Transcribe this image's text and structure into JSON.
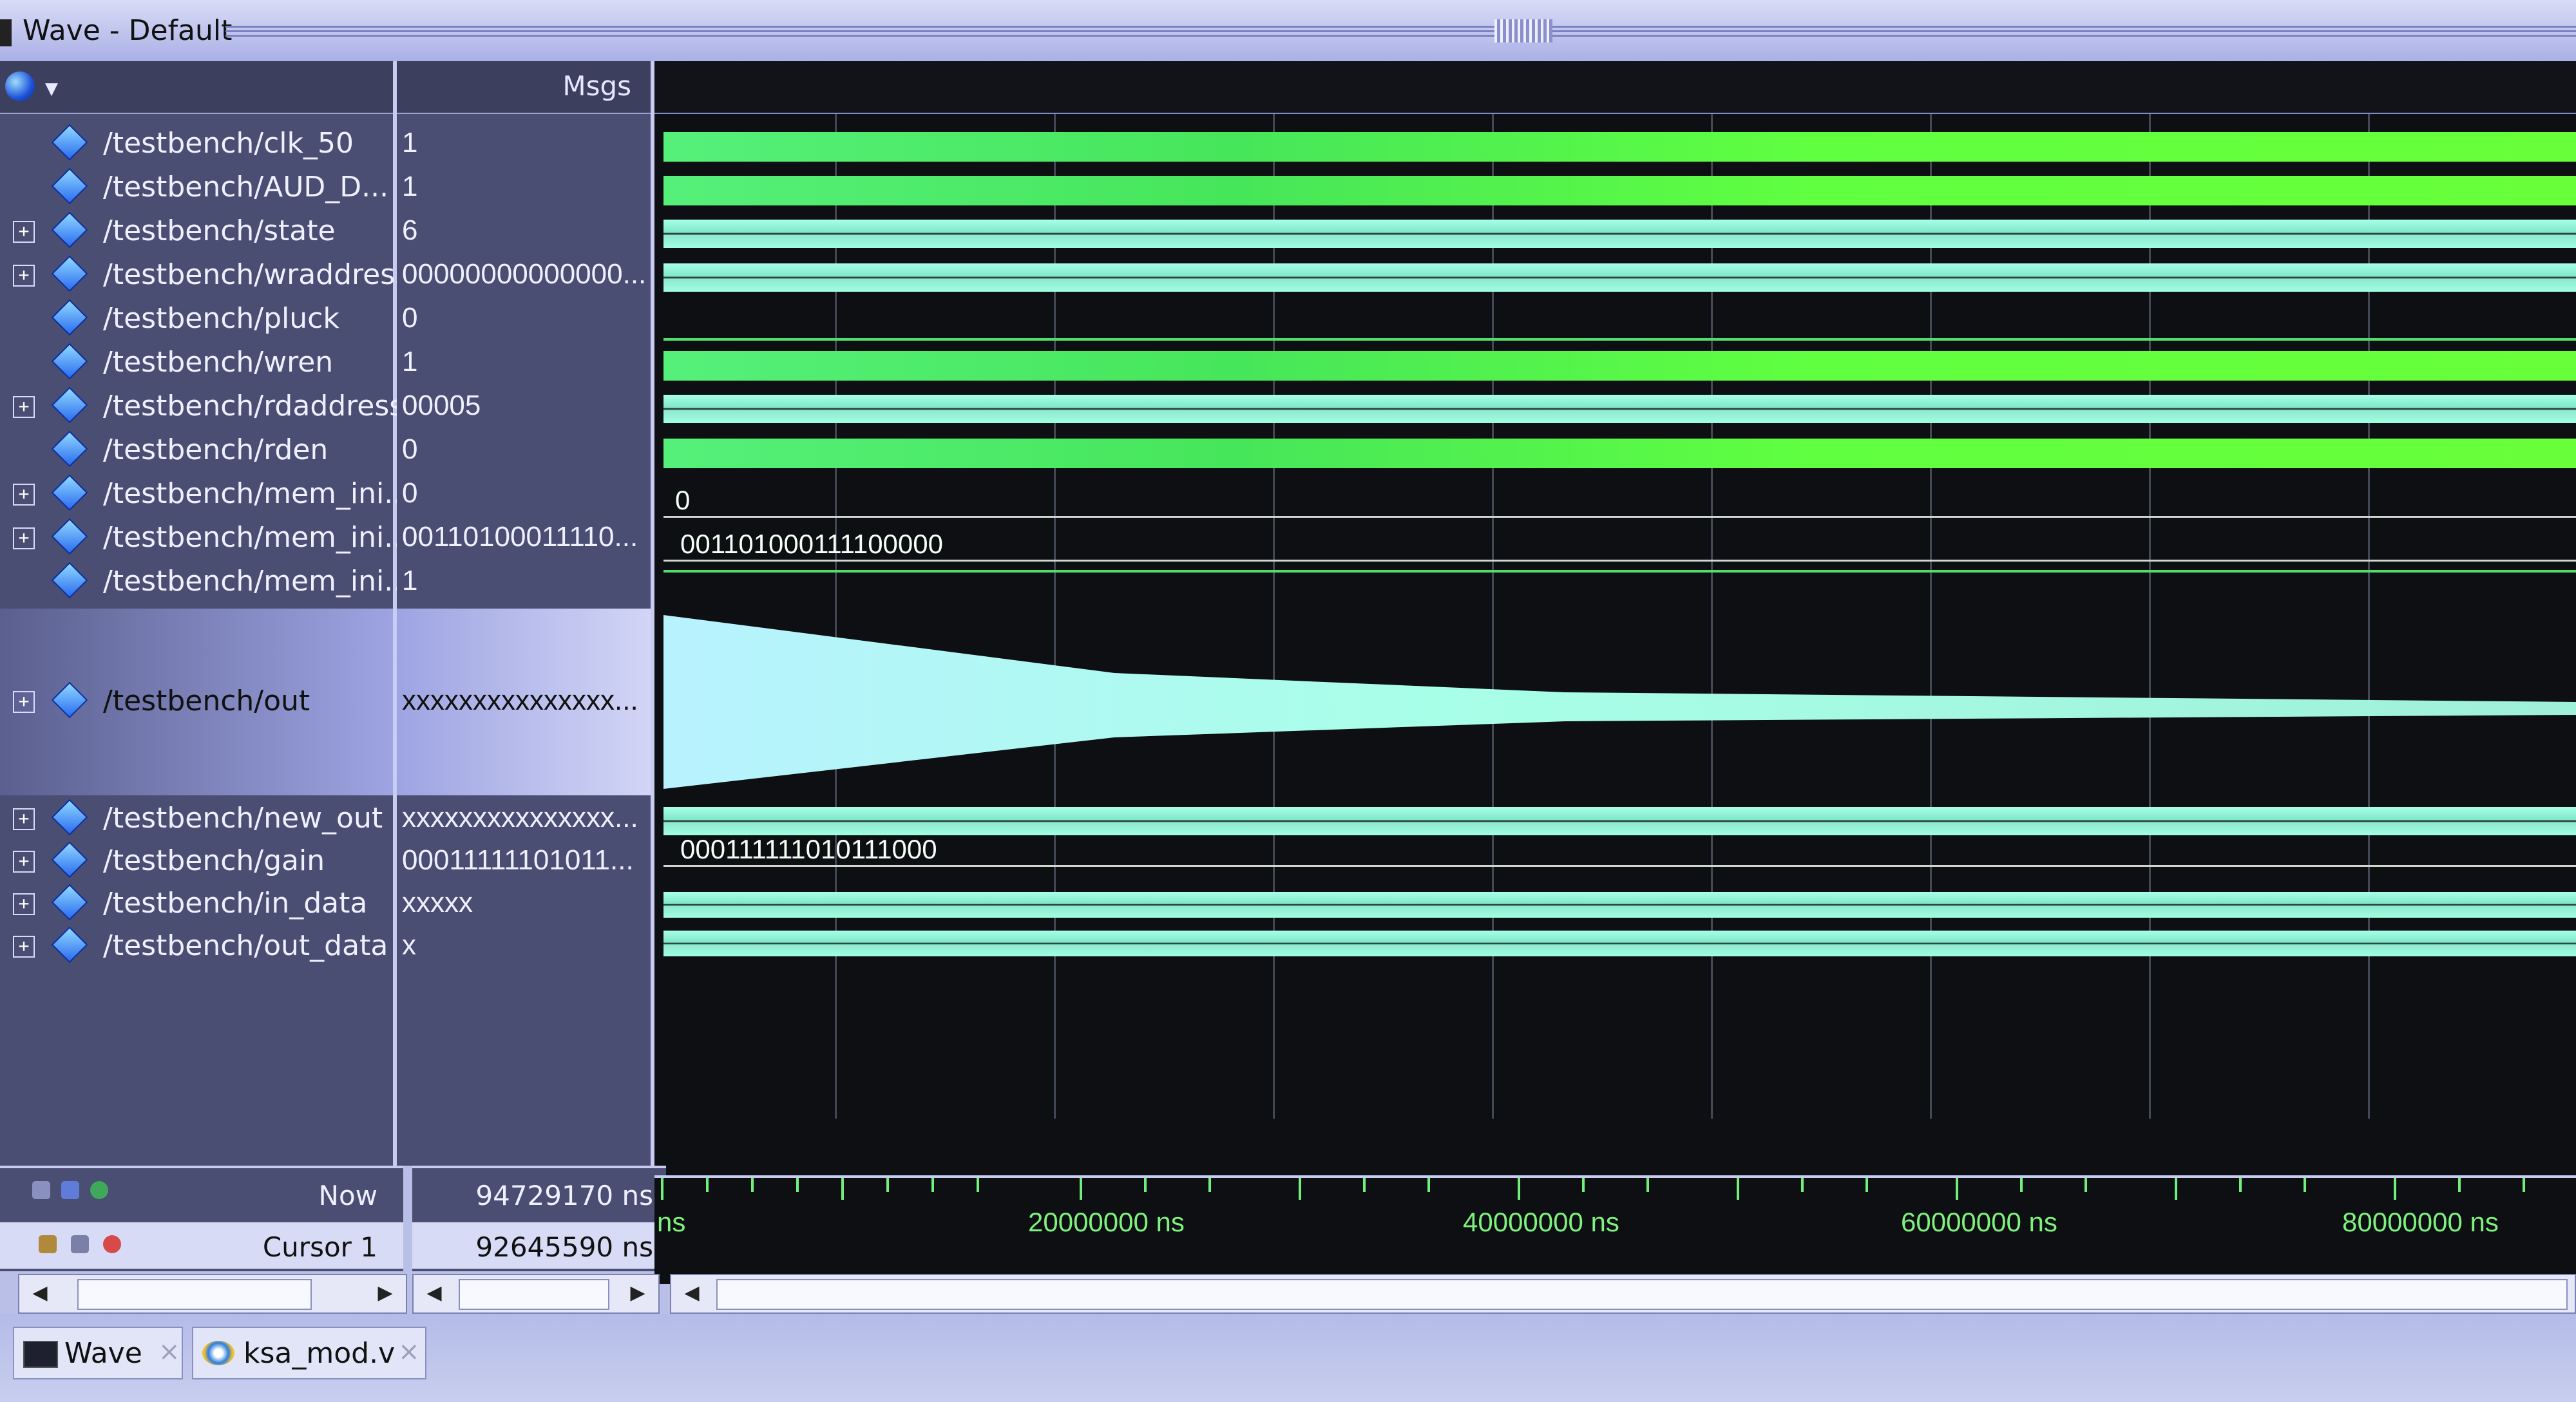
{
  "window": {
    "title": "Wave - Default"
  },
  "columns": {
    "msgs_header": "Msgs"
  },
  "signals": [
    {
      "name": "/testbench/clk_50",
      "value": "1",
      "expandable": false
    },
    {
      "name": "/testbench/AUD_D...",
      "value": "1",
      "expandable": false
    },
    {
      "name": "/testbench/state",
      "value": "6",
      "expandable": true
    },
    {
      "name": "/testbench/wraddress",
      "value": "00000000000000...",
      "expandable": true
    },
    {
      "name": "/testbench/pluck",
      "value": "0",
      "expandable": false
    },
    {
      "name": "/testbench/wren",
      "value": "1",
      "expandable": false
    },
    {
      "name": "/testbench/rdaddress",
      "value": "00005",
      "expandable": true
    },
    {
      "name": "/testbench/rden",
      "value": "0",
      "expandable": false
    },
    {
      "name": "/testbench/mem_ini...",
      "value": "0",
      "expandable": true
    },
    {
      "name": "/testbench/mem_ini...",
      "value": "00110100011110...",
      "expandable": true
    },
    {
      "name": "/testbench/mem_ini...",
      "value": "1",
      "expandable": false
    },
    {
      "name": "/testbench/out",
      "value": "xxxxxxxxxxxxxxx...",
      "expandable": true
    },
    {
      "name": "/testbench/new_out",
      "value": "xxxxxxxxxxxxxxx...",
      "expandable": true
    },
    {
      "name": "/testbench/gain",
      "value": "00011111101011...",
      "expandable": true
    },
    {
      "name": "/testbench/in_data",
      "value": "xxxxx",
      "expandable": true
    },
    {
      "name": "/testbench/out_data",
      "value": "x",
      "expandable": true
    }
  ],
  "wave_labels": {
    "mem_init_a": "0",
    "mem_init_b": "001101000111100000",
    "gain": "000111111010111000"
  },
  "footer": {
    "now_label": "Now",
    "now_value": "94729170 ns",
    "cursor_label": "Cursor 1",
    "cursor_value": "92645590 ns"
  },
  "axis": {
    "start_label": "ns",
    "labels": [
      "20000000 ns",
      "40000000 ns",
      "60000000 ns",
      "80000000 ns"
    ]
  },
  "tabs": [
    {
      "label": "Wave",
      "icon": "wave-window-icon"
    },
    {
      "label": "ksa_mod.v",
      "icon": "source-file-icon"
    }
  ],
  "colors": {
    "wave_green": "#46e65a",
    "bus_cyan": "#8fe8d0",
    "axis_text": "#7ff27e",
    "panel_bg": "#4a4e72"
  }
}
